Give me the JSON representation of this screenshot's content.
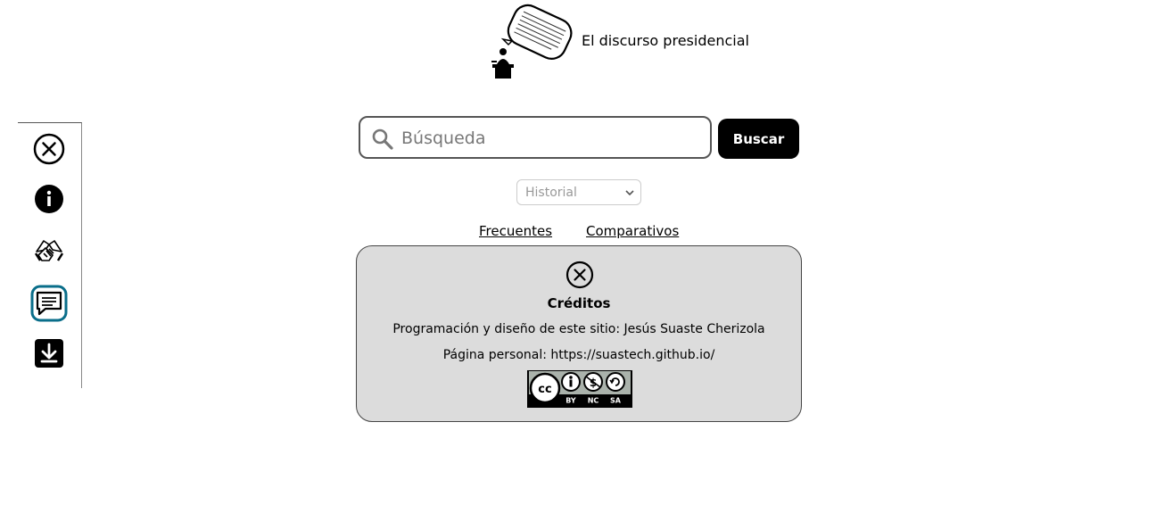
{
  "header": {
    "title": "El discurso presidencial",
    "logo_icon": "speaker-podium-speech-bubble-icon"
  },
  "sidebar": {
    "items": [
      {
        "name": "close",
        "icon": "close-circle-icon"
      },
      {
        "name": "info",
        "icon": "info-icon"
      },
      {
        "name": "collaboration",
        "icon": "handshake-icon"
      },
      {
        "name": "comments",
        "icon": "chat-bubble-icon",
        "active": true
      },
      {
        "name": "download",
        "icon": "download-icon"
      }
    ],
    "active_color": "#0a6e8a"
  },
  "search": {
    "placeholder": "Búsqueda",
    "value": "",
    "button_label": "Buscar"
  },
  "history_select": {
    "selected": "Historial"
  },
  "links": {
    "frecuentes": "Frecuentes",
    "comparativos": "Comparativos"
  },
  "credits": {
    "title": "Créditos",
    "line1": "Programación y diseño de este sitio: Jesús Suaste Cherizola",
    "line2": "Página personal: https://suastech.github.io/",
    "license_badge": {
      "icon": "creative-commons-by-nc-sa-icon",
      "labels": [
        "BY",
        "NC",
        "SA"
      ]
    }
  },
  "colors": {
    "panel_bg": "#dcdcdc",
    "button_bg": "#000000",
    "accent": "#0a6e8a"
  }
}
